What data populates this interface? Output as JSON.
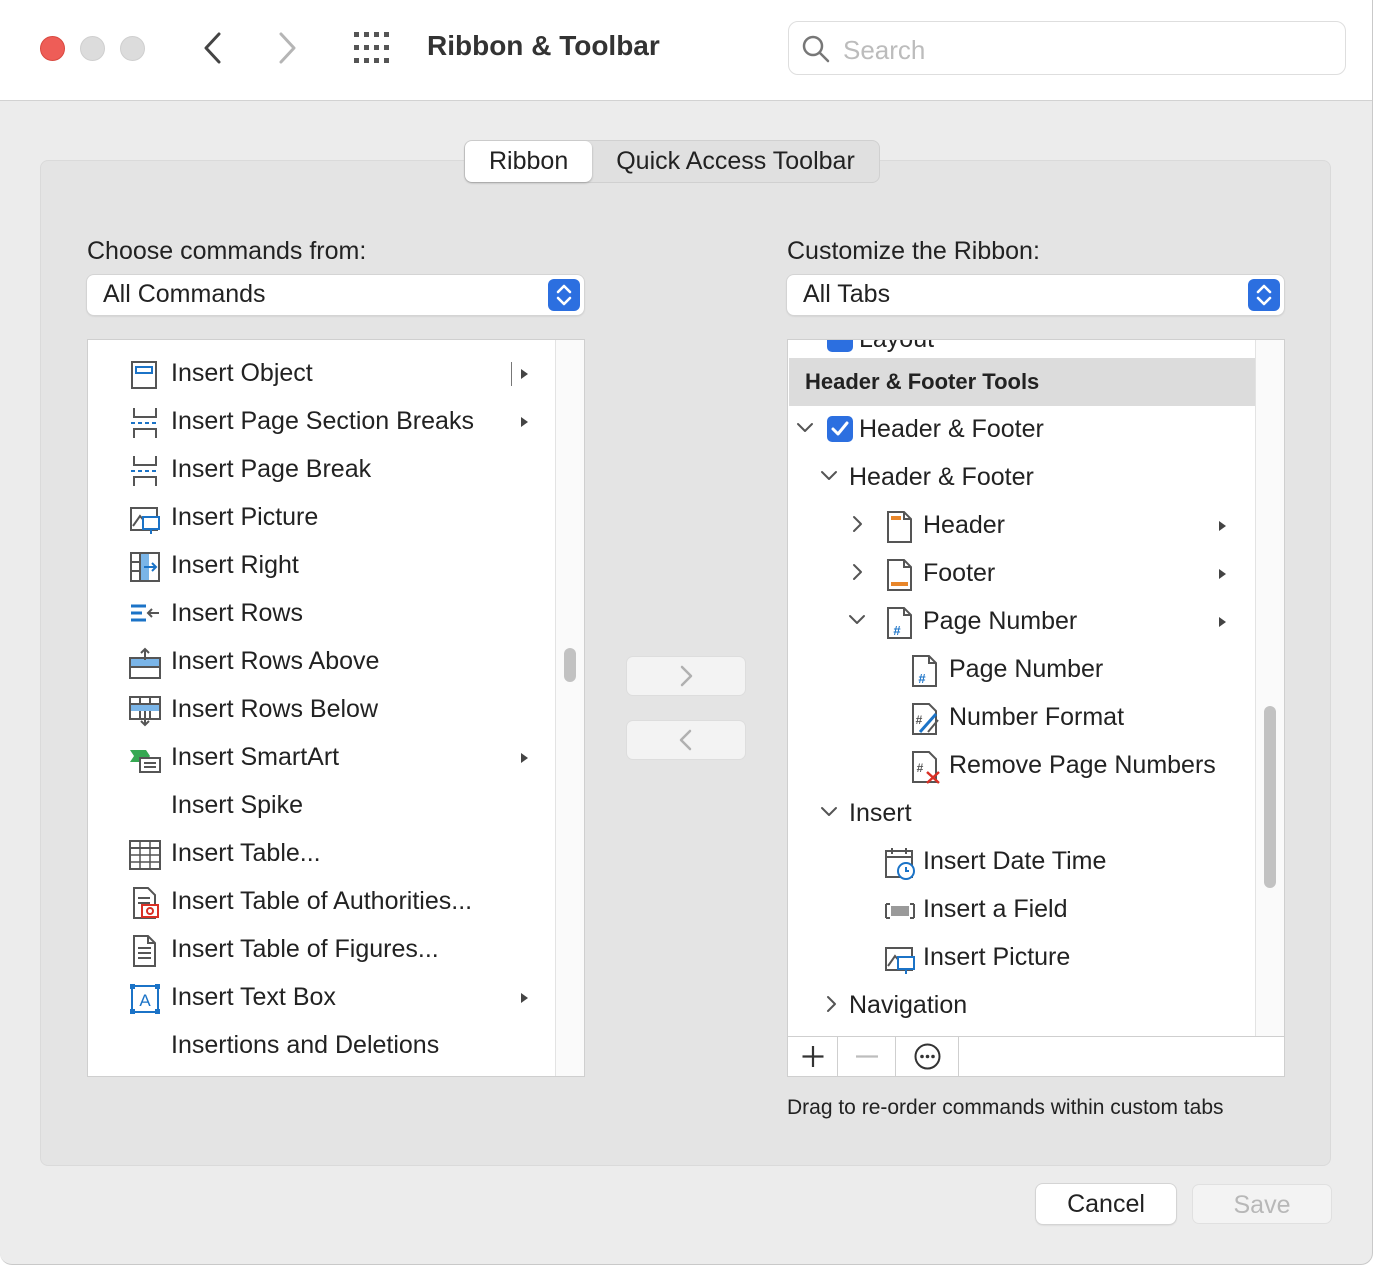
{
  "window": {
    "title": "Ribbon & Toolbar",
    "search_placeholder": "Search"
  },
  "tabs": [
    {
      "label": "Ribbon",
      "active": true
    },
    {
      "label": "Quick Access Toolbar",
      "active": false
    }
  ],
  "left": {
    "label": "Choose commands from:",
    "select_value": "All Commands",
    "items": [
      {
        "label": "Insert Object",
        "icon": "insert-object-icon",
        "submenu": true
      },
      {
        "label": "Insert Page  Section Breaks",
        "icon": "page-section-break-icon",
        "submenu": true
      },
      {
        "label": "Insert Page Break",
        "icon": "page-break-icon",
        "submenu": false
      },
      {
        "label": "Insert Picture",
        "icon": "picture-icon",
        "submenu": false
      },
      {
        "label": "Insert Right",
        "icon": "insert-column-right-icon",
        "submenu": false
      },
      {
        "label": "Insert Rows",
        "icon": "insert-rows-icon",
        "submenu": false
      },
      {
        "label": "Insert Rows Above",
        "icon": "insert-rows-above-icon",
        "submenu": false
      },
      {
        "label": "Insert Rows Below",
        "icon": "insert-rows-below-icon",
        "submenu": false
      },
      {
        "label": "Insert SmartArt",
        "icon": "smartart-icon",
        "submenu": true
      },
      {
        "label": "Insert Spike",
        "icon": "",
        "submenu": false
      },
      {
        "label": "Insert Table...",
        "icon": "table-icon",
        "submenu": false
      },
      {
        "label": "Insert Table of Authorities...",
        "icon": "table-of-authorities-icon",
        "submenu": false
      },
      {
        "label": "Insert Table of Figures...",
        "icon": "table-of-figures-icon",
        "submenu": false
      },
      {
        "label": "Insert Text Box",
        "icon": "text-box-icon",
        "submenu": true
      },
      {
        "label": "Insertions and Deletions",
        "icon": "",
        "submenu": false
      }
    ]
  },
  "right": {
    "label": "Customize the Ribbon:",
    "select_value": "All Tabs",
    "partial_item": "Layout",
    "group_header": "Header & Footer Tools",
    "tree": [
      {
        "label": "Header & Footer",
        "level": 0,
        "chevron": "down",
        "checkbox": true,
        "checked": true,
        "icon": "",
        "submenu": false
      },
      {
        "label": "Header & Footer",
        "level": 1,
        "chevron": "down",
        "checkbox": false,
        "icon": "",
        "submenu": false
      },
      {
        "label": "Header",
        "level": 2,
        "chevron": "right",
        "checkbox": false,
        "icon": "header-icon",
        "submenu": true
      },
      {
        "label": "Footer",
        "level": 2,
        "chevron": "right",
        "checkbox": false,
        "icon": "footer-icon",
        "submenu": true
      },
      {
        "label": "Page Number",
        "level": 2,
        "chevron": "down",
        "checkbox": false,
        "icon": "page-number-icon",
        "submenu": true
      },
      {
        "label": "Page Number",
        "level": 3,
        "chevron": "",
        "checkbox": false,
        "icon": "page-number-icon",
        "submenu": false
      },
      {
        "label": "Number Format",
        "level": 3,
        "chevron": "",
        "checkbox": false,
        "icon": "number-format-icon",
        "submenu": false
      },
      {
        "label": "Remove Page Numbers",
        "level": 3,
        "chevron": "",
        "checkbox": false,
        "icon": "remove-page-numbers-icon",
        "submenu": false
      },
      {
        "label": "Insert",
        "level": 1,
        "chevron": "down",
        "checkbox": false,
        "icon": "",
        "submenu": false
      },
      {
        "label": "Insert Date  Time",
        "level": 2,
        "chevron": "",
        "checkbox": false,
        "icon": "date-time-icon",
        "submenu": false
      },
      {
        "label": "Insert a Field",
        "level": 2,
        "chevron": "",
        "checkbox": false,
        "icon": "field-icon",
        "submenu": false
      },
      {
        "label": "Insert Picture",
        "level": 2,
        "chevron": "",
        "checkbox": false,
        "icon": "picture-icon",
        "submenu": false
      },
      {
        "label": "Navigation",
        "level": 1,
        "chevron": "right",
        "checkbox": false,
        "icon": "",
        "submenu": false
      }
    ],
    "toolbar": {
      "add": "+",
      "remove": "−",
      "more": "⋯"
    },
    "hint": "Drag to re-order commands within custom tabs"
  },
  "buttons": {
    "cancel": "Cancel",
    "save": "Save"
  },
  "colors": {
    "accent": "#2c6fe0",
    "close": "#ee5d57",
    "orange": "#e8862a",
    "red": "#d93025"
  }
}
